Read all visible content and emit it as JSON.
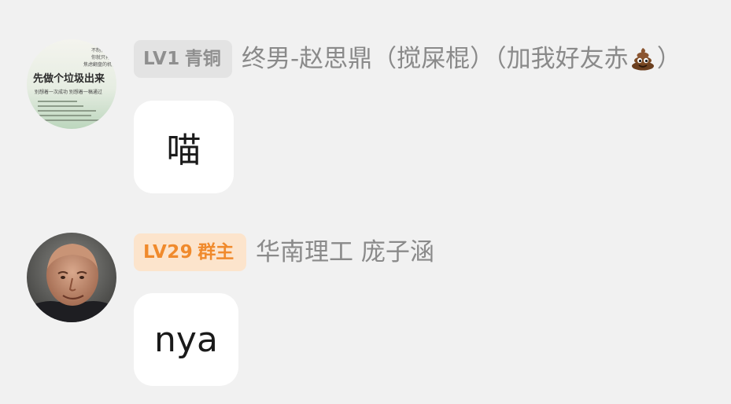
{
  "messages": [
    {
      "avatar": {
        "icon": "book-cover-avatar",
        "cover_title": "先做个垃圾出来",
        "cover_lines": [
          "不制作垃圾",
          "你就只有",
          "焦虑翻盘的机会",
          "别想着一次成功 别想着一稿通过"
        ]
      },
      "badge": {
        "level": "LV1",
        "role": "青铜",
        "bg": "#e3e3e3",
        "color": "#8f8f8f"
      },
      "sender": {
        "text_before": "终男-赵思鼎（搅屎棍）（加我好友赤",
        "emoji": "pile-of-poo-icon",
        "text_after": "）"
      },
      "text": "喵"
    },
    {
      "avatar": {
        "icon": "man-portrait-avatar"
      },
      "badge": {
        "level": "LV29",
        "role": "群主",
        "bg": "#fce4cc",
        "color": "#f08a2c"
      },
      "sender": {
        "text": "华南理工 庞子涵"
      },
      "text": "nya"
    }
  ]
}
